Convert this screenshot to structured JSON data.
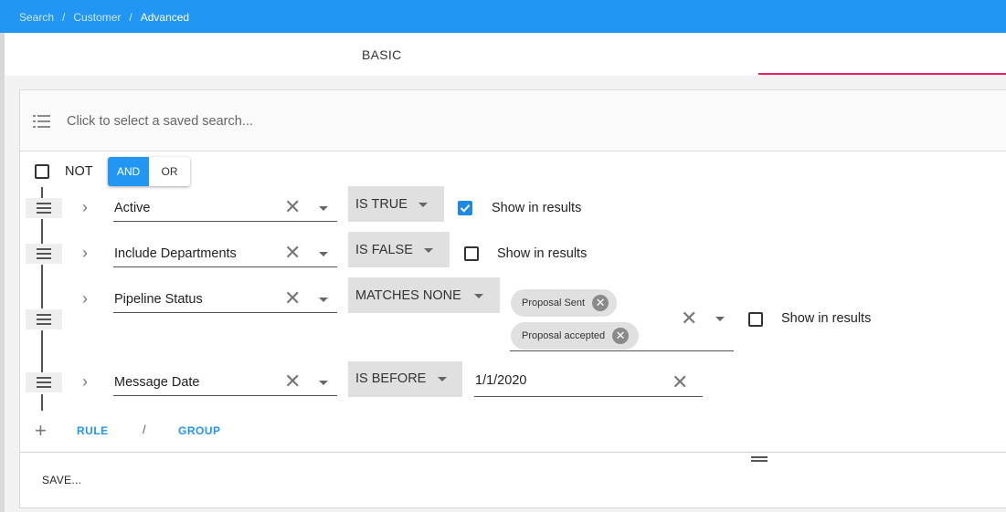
{
  "breadcrumb": {
    "items": [
      "Search",
      "Customer",
      "Advanced"
    ],
    "separator": "/"
  },
  "tabs": {
    "basic_label": "BASIC"
  },
  "saved_search": {
    "placeholder": "Click to select a saved search..."
  },
  "group": {
    "not_label": "NOT",
    "not_checked": false,
    "and_label": "AND",
    "or_label": "OR",
    "active_operator": "AND"
  },
  "rules": [
    {
      "field": "Active",
      "operator": "IS TRUE",
      "show_label": "Show in results",
      "show_checked": true
    },
    {
      "field": "Include Departments",
      "operator": "IS FALSE",
      "show_label": "Show in results",
      "show_checked": false
    },
    {
      "field": "Pipeline Status",
      "operator": "MATCHES NONE",
      "chips": [
        "Proposal Sent",
        "Proposal accepted"
      ],
      "show_label": "Show in results",
      "show_checked": false
    },
    {
      "field": "Message Date",
      "operator": "IS BEFORE",
      "value": "1/1/2020"
    }
  ],
  "add": {
    "rule_label": "RULE",
    "separator": "/",
    "group_label": "GROUP"
  },
  "footer": {
    "save_label": "SAVE..."
  },
  "colors": {
    "primary": "#2196f3",
    "tab_indicator": "#e91e63",
    "op_bg": "#e0e0e0"
  }
}
